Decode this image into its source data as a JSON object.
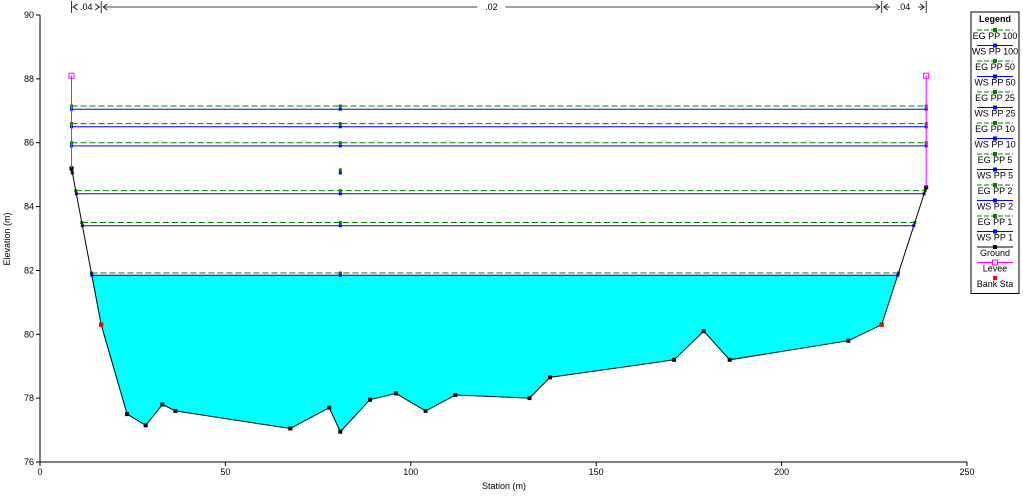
{
  "chart_data": {
    "type": "line",
    "xlabel": "Station (m)",
    "ylabel": "Elevation (m)",
    "xlim": [
      0,
      250
    ],
    "ylim": [
      76,
      90
    ],
    "x_ticks": [
      0,
      50,
      100,
      150,
      200,
      250
    ],
    "y_ticks": [
      76,
      78,
      80,
      82,
      84,
      86,
      88,
      90
    ],
    "grid": false,
    "legend_title": "Legend",
    "legend_position": "right",
    "ground": {
      "name": "Ground",
      "color": "#000000",
      "points": [
        [
          8.5,
          85.2
        ],
        [
          16.5,
          80.3
        ],
        [
          23.5,
          77.5
        ],
        [
          28.5,
          77.15
        ],
        [
          33,
          77.8
        ],
        [
          36.5,
          77.6
        ],
        [
          67.5,
          77.05
        ],
        [
          78,
          77.7
        ],
        [
          81,
          76.95
        ],
        [
          89,
          77.95
        ],
        [
          96,
          78.15
        ],
        [
          104,
          77.6
        ],
        [
          112,
          78.1
        ],
        [
          132,
          78.0
        ],
        [
          137.5,
          78.65
        ],
        [
          171,
          79.2
        ],
        [
          179,
          80.1
        ],
        [
          186,
          79.2
        ],
        [
          218,
          79.8
        ],
        [
          227,
          80.3
        ],
        [
          239,
          84.6
        ]
      ]
    },
    "levees": {
      "name": "Levee",
      "color": "#ff00ff",
      "left": [
        8.5,
        88.1
      ],
      "right": [
        239,
        88.1
      ]
    },
    "bank_stations": {
      "name": "Bank Sta",
      "color": "#ff0000",
      "points": [
        [
          16.5,
          80.3
        ],
        [
          227,
          80.3
        ]
      ]
    },
    "manning_n": [
      {
        "value": ".04",
        "from": 8.5,
        "to": 16.5
      },
      {
        "value": ".02",
        "from": 16.5,
        "to": 227
      },
      {
        "value": ".04",
        "from": 227,
        "to": 239
      }
    ],
    "water_fill_color": "#00ffff",
    "filled_profile": "WS PP 1",
    "series": [
      {
        "name": "EG PP 100",
        "type": "EG",
        "value": 87.15,
        "color": "#008000"
      },
      {
        "name": "WS PP 100",
        "type": "WS",
        "value": 87.05,
        "color": "#0000ff"
      },
      {
        "name": "EG PP 50",
        "type": "EG",
        "value": 86.6,
        "color": "#008000"
      },
      {
        "name": "WS PP 50",
        "type": "WS",
        "value": 86.5,
        "color": "#0000ff"
      },
      {
        "name": "EG PP 25",
        "type": "EG",
        "value": 86.0,
        "color": "#008000"
      },
      {
        "name": "WS PP 25",
        "type": "WS",
        "value": 85.9,
        "color": "#0000ff"
      },
      {
        "name": "EG PP 10",
        "type": "EG",
        "value": 85.15,
        "color": "#008000"
      },
      {
        "name": "WS PP 10",
        "type": "WS",
        "value": 85.05,
        "color": "#0000ff"
      },
      {
        "name": "EG PP 5",
        "type": "EG",
        "value": 84.5,
        "color": "#008000"
      },
      {
        "name": "WS PP 5",
        "type": "WS",
        "value": 84.4,
        "color": "#0000ff"
      },
      {
        "name": "EG PP 2",
        "type": "EG",
        "value": 83.5,
        "color": "#008000"
      },
      {
        "name": "WS PP 2",
        "type": "WS",
        "value": 83.4,
        "color": "#0000ff"
      },
      {
        "name": "EG PP 1",
        "type": "EG",
        "value": 81.92,
        "color": "#008000"
      },
      {
        "name": "WS PP 1",
        "type": "WS",
        "value": 81.85,
        "color": "#0000ff"
      }
    ],
    "legend_items": [
      "EG PP 100",
      "WS PP 100",
      "EG PP 50",
      "WS PP 50",
      "EG PP 25",
      "WS PP 25",
      "EG PP 10",
      "WS PP 10",
      "EG PP 5",
      "WS PP 5",
      "EG PP 2",
      "WS PP 2",
      "EG PP 1",
      "WS PP 1",
      "Ground",
      "Levee",
      "Bank Sta"
    ]
  }
}
